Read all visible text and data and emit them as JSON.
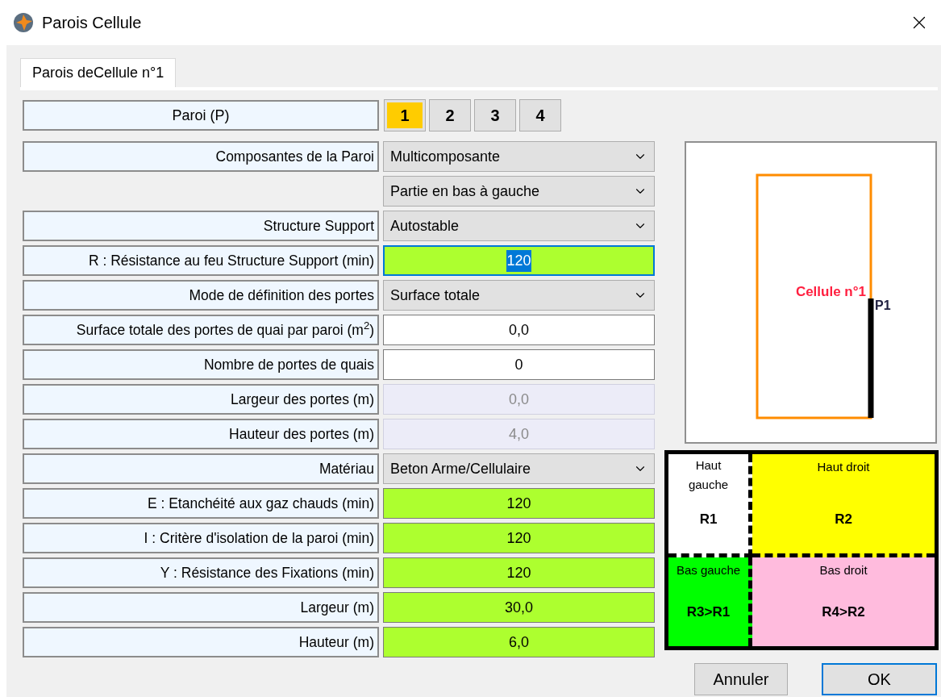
{
  "window": {
    "title": "Parois Cellule"
  },
  "tabs": [
    {
      "label": "Parois deCellule n°1",
      "selected": true
    }
  ],
  "wall_selector": {
    "label": "Paroi (P)",
    "walls": [
      {
        "label": "1",
        "selected": true
      },
      {
        "label": "2",
        "selected": false
      },
      {
        "label": "3",
        "selected": false
      },
      {
        "label": "4",
        "selected": false
      }
    ]
  },
  "rows": [
    {
      "label": "Composantes de la Paroi",
      "kind": "select",
      "value": "Multicomposante"
    },
    {
      "kind": "select",
      "value": "Partie en bas à gauche"
    },
    {
      "label": "Structure Support",
      "kind": "select",
      "value": "Autostable"
    },
    {
      "label": "R : Résistance au feu  Structure Support (min)",
      "kind": "valid",
      "value": "120",
      "focused": true
    },
    {
      "label": "Mode de définition des portes",
      "kind": "select",
      "value": "Surface totale"
    },
    {
      "label": "Surface totale des portes de quai par paroi (m$^{2}$)",
      "kind": "input",
      "value": "0,0"
    },
    {
      "label": "Nombre de portes de quais",
      "kind": "input",
      "value": "0"
    },
    {
      "label": "Largeur des portes (m)",
      "kind": "disabled",
      "value": "0,0"
    },
    {
      "label": "Hauteur des  portes (m)",
      "kind": "disabled",
      "value": "4,0"
    },
    {
      "label": "Matériau",
      "kind": "select",
      "value": "Beton Arme/Cellulaire"
    },
    {
      "label": "E : Etanchéité aux gaz chauds (min)",
      "kind": "valid",
      "value": "120",
      "focused": false
    },
    {
      "label": "I : Critère d'isolation de la paroi (min)",
      "kind": "valid",
      "value": "120",
      "focused": false
    },
    {
      "label": "Y : Résistance des Fixations (min)",
      "kind": "valid",
      "value": "120",
      "focused": false
    },
    {
      "label": "Largeur (m)",
      "kind": "valid",
      "value": "30,0",
      "focused": false
    },
    {
      "label": "Hauteur (m)",
      "kind": "valid",
      "value": "6,0",
      "focused": false
    }
  ],
  "plan": {
    "cell_label": "Cellule n°1",
    "wall_label": "P1"
  },
  "quadrants": [
    {
      "title": "Haut gauche",
      "code": "R1",
      "color": "#ffffff"
    },
    {
      "title": "Haut droit",
      "code": "R2",
      "color": "#ffff00"
    },
    {
      "title": "Bas gauche",
      "code": "R3>R1",
      "color": "#00ff00"
    },
    {
      "title": "Bas droit",
      "code": "R4>R2",
      "color": "#ffbbdd"
    }
  ],
  "buttons": [
    {
      "label": "Annuler",
      "default": false
    },
    {
      "label": "OK",
      "default": true
    }
  ]
}
